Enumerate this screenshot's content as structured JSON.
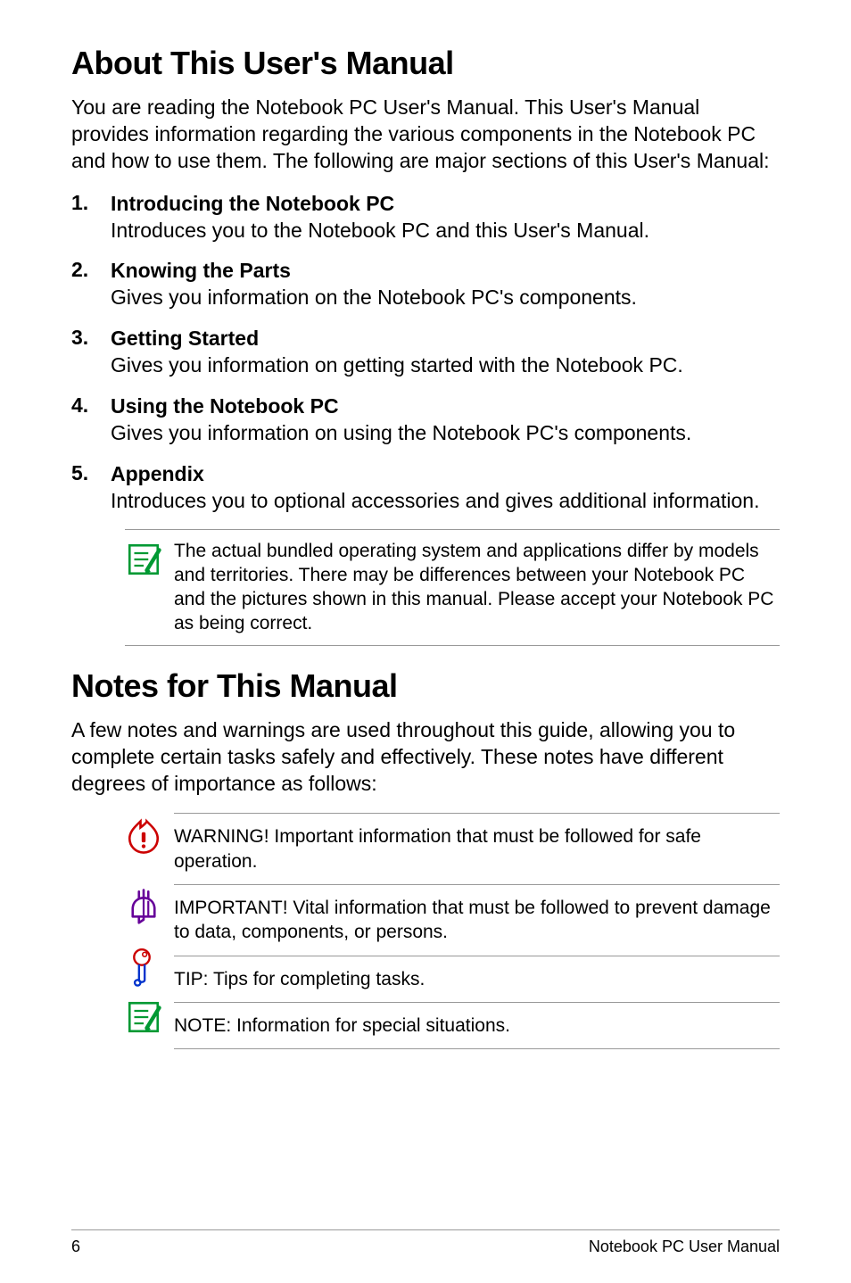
{
  "heading1": "About This User's Manual",
  "intro1": "You are reading the Notebook PC User's Manual. This User's Manual provides information regarding the various components in the Notebook PC and how to use them. The following are major sections of this User's Manual:",
  "sections": [
    {
      "num": "1.",
      "title": "Introducing the Notebook PC",
      "desc": "Introduces you to the Notebook PC and this User's Manual."
    },
    {
      "num": "2.",
      "title": "Knowing the Parts",
      "desc": "Gives you information on the Notebook PC's components."
    },
    {
      "num": "3.",
      "title": "Getting Started",
      "desc": "Gives you information on getting started with the Notebook PC."
    },
    {
      "num": "4.",
      "title": "Using the Notebook PC",
      "desc": "Gives you information on using the Notebook PC's components."
    },
    {
      "num": "5.",
      "title": "Appendix",
      "desc": "Introduces you to optional accessories and gives additional information."
    }
  ],
  "note_callout": "The actual bundled operating system and applications differ by models and territories. There may be differences between your Notebook PC and the pictures shown in this manual. Please accept your Notebook PC as being correct.",
  "heading2": "Notes for This Manual",
  "intro2": "A few notes and warnings are used throughout this guide, allowing you to complete certain tasks safely and effectively. These notes have different degrees of importance as follows:",
  "notes": [
    {
      "label": "WARNING!",
      "text": " Important information that must be followed for safe operation."
    },
    {
      "label": "IMPORTANT!",
      "text": " Vital information that must be followed to prevent damage to data, components, or persons."
    },
    {
      "label": "TIP:",
      "text": " Tips for completing tasks."
    },
    {
      "label": "NOTE:",
      "text": "  Information for special situations."
    }
  ],
  "footer": {
    "page": "6",
    "title": "Notebook PC User Manual"
  }
}
